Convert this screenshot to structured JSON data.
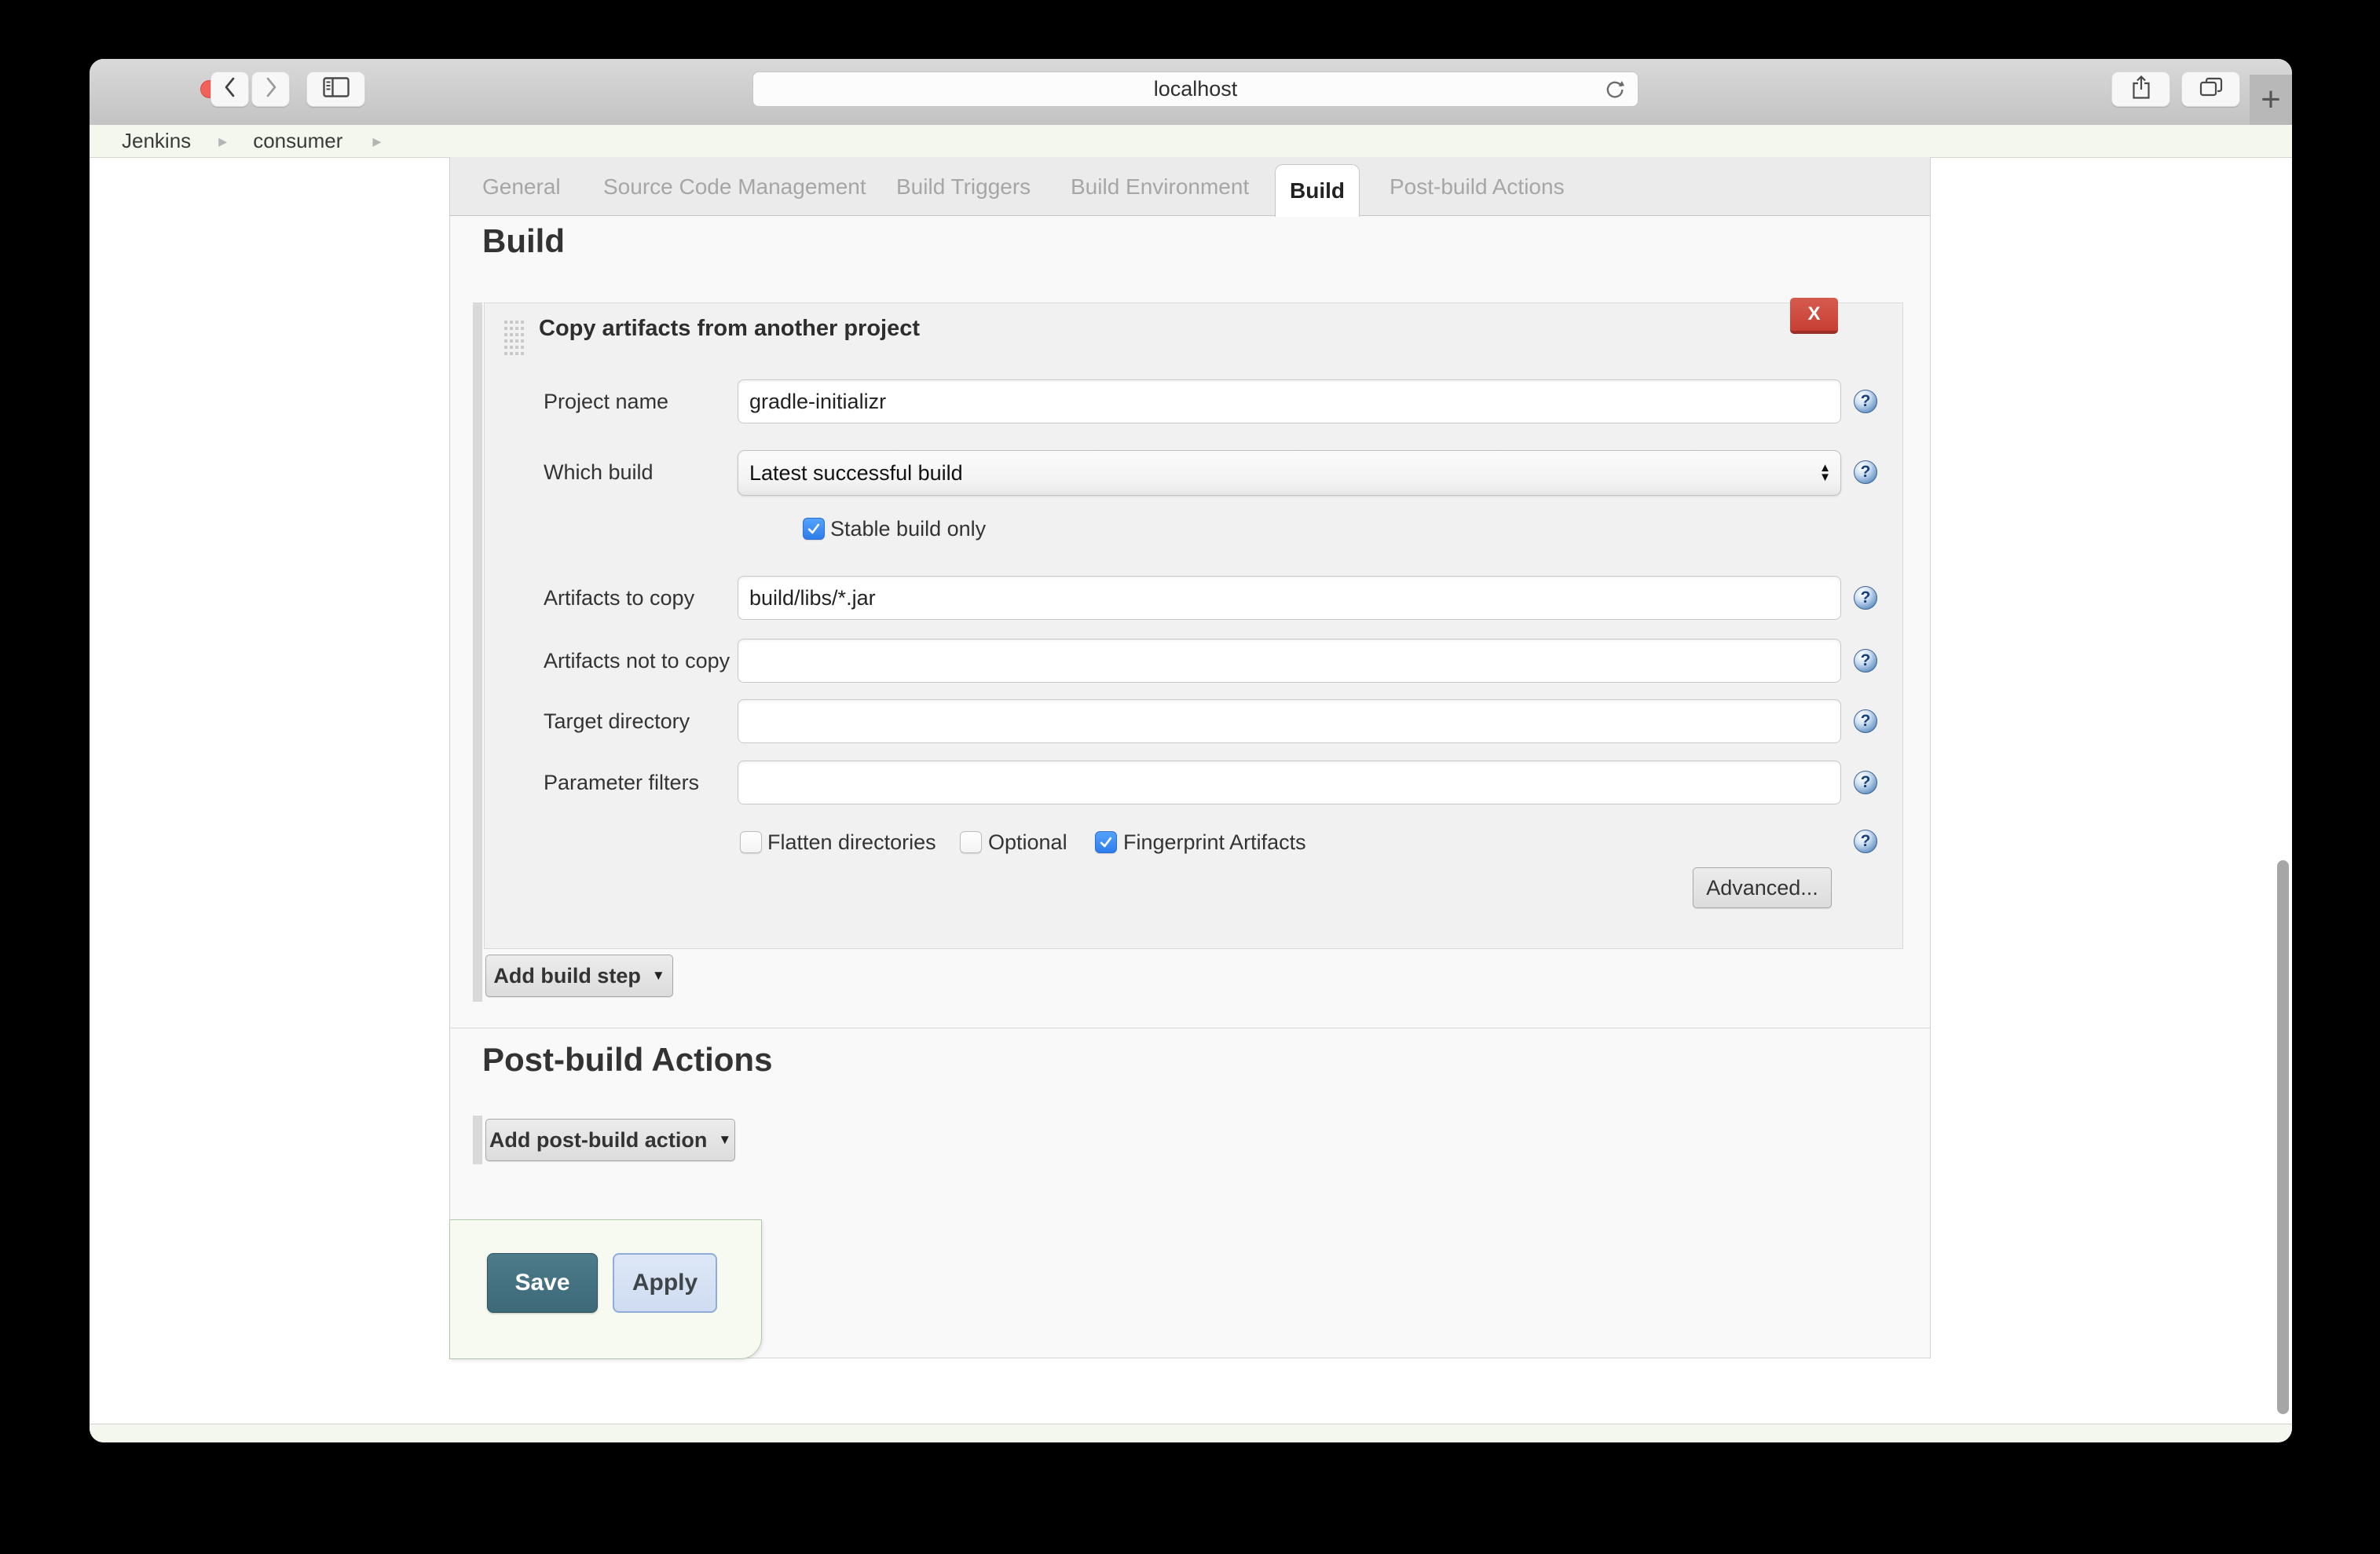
{
  "browser": {
    "url_text": "localhost",
    "breadcrumb": {
      "items": [
        "Jenkins",
        "consumer"
      ]
    }
  },
  "config_tabs": {
    "items": [
      {
        "label": "General",
        "active": false
      },
      {
        "label": "Source Code Management",
        "active": false
      },
      {
        "label": "Build Triggers",
        "active": false
      },
      {
        "label": "Build Environment",
        "active": false
      },
      {
        "label": "Build",
        "active": true
      },
      {
        "label": "Post-build Actions",
        "active": false
      }
    ]
  },
  "build": {
    "heading": "Build",
    "step": {
      "title": "Copy artifacts from another project",
      "remove_label": "X",
      "rows": {
        "project_name": {
          "label": "Project name",
          "value": "gradle-initializr"
        },
        "which_build": {
          "label": "Which build",
          "value": "Latest successful build"
        },
        "stable_build_only": {
          "label": "Stable build only",
          "checked": true
        },
        "artifacts_to_copy": {
          "label": "Artifacts to copy",
          "value": "build/libs/*.jar"
        },
        "artifacts_not_to_copy": {
          "label": "Artifacts not to copy",
          "value": ""
        },
        "target_directory": {
          "label": "Target directory",
          "value": ""
        },
        "parameter_filters": {
          "label": "Parameter filters",
          "value": ""
        },
        "options": [
          {
            "label": "Flatten directories",
            "checked": false
          },
          {
            "label": "Optional",
            "checked": false
          },
          {
            "label": "Fingerprint Artifacts",
            "checked": true
          }
        ]
      },
      "advanced_label": "Advanced..."
    },
    "add_build_step_label": "Add build step"
  },
  "post_build": {
    "heading": "Post-build Actions",
    "add_label": "Add post-build action"
  },
  "footer_actions": {
    "save": "Save",
    "apply": "Apply"
  },
  "icons": {
    "help": "?",
    "caret_down": "▼",
    "spinner_up": "▲",
    "spinner_down": "▼",
    "plus": "+",
    "breadcrumb_sep": "▸"
  },
  "colors": {
    "delete_button": "#c83f34",
    "checked_checkbox": "#2e7de9",
    "save_button": "#44717f",
    "apply_button_bg": "#d7e2f4",
    "help_icon": "#416d9c",
    "breadcrumb_bar_bg": "#f4f7ee"
  }
}
